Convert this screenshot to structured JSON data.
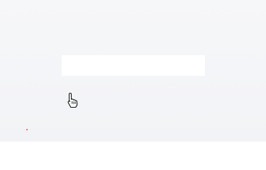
{
  "input": {
    "value": "",
    "placeholder": ""
  },
  "cursor": {
    "icon": "hand-pointer-icon"
  },
  "colors": {
    "background": "#f4f5f7",
    "field": "#ffffff",
    "dot": "#e04848"
  }
}
